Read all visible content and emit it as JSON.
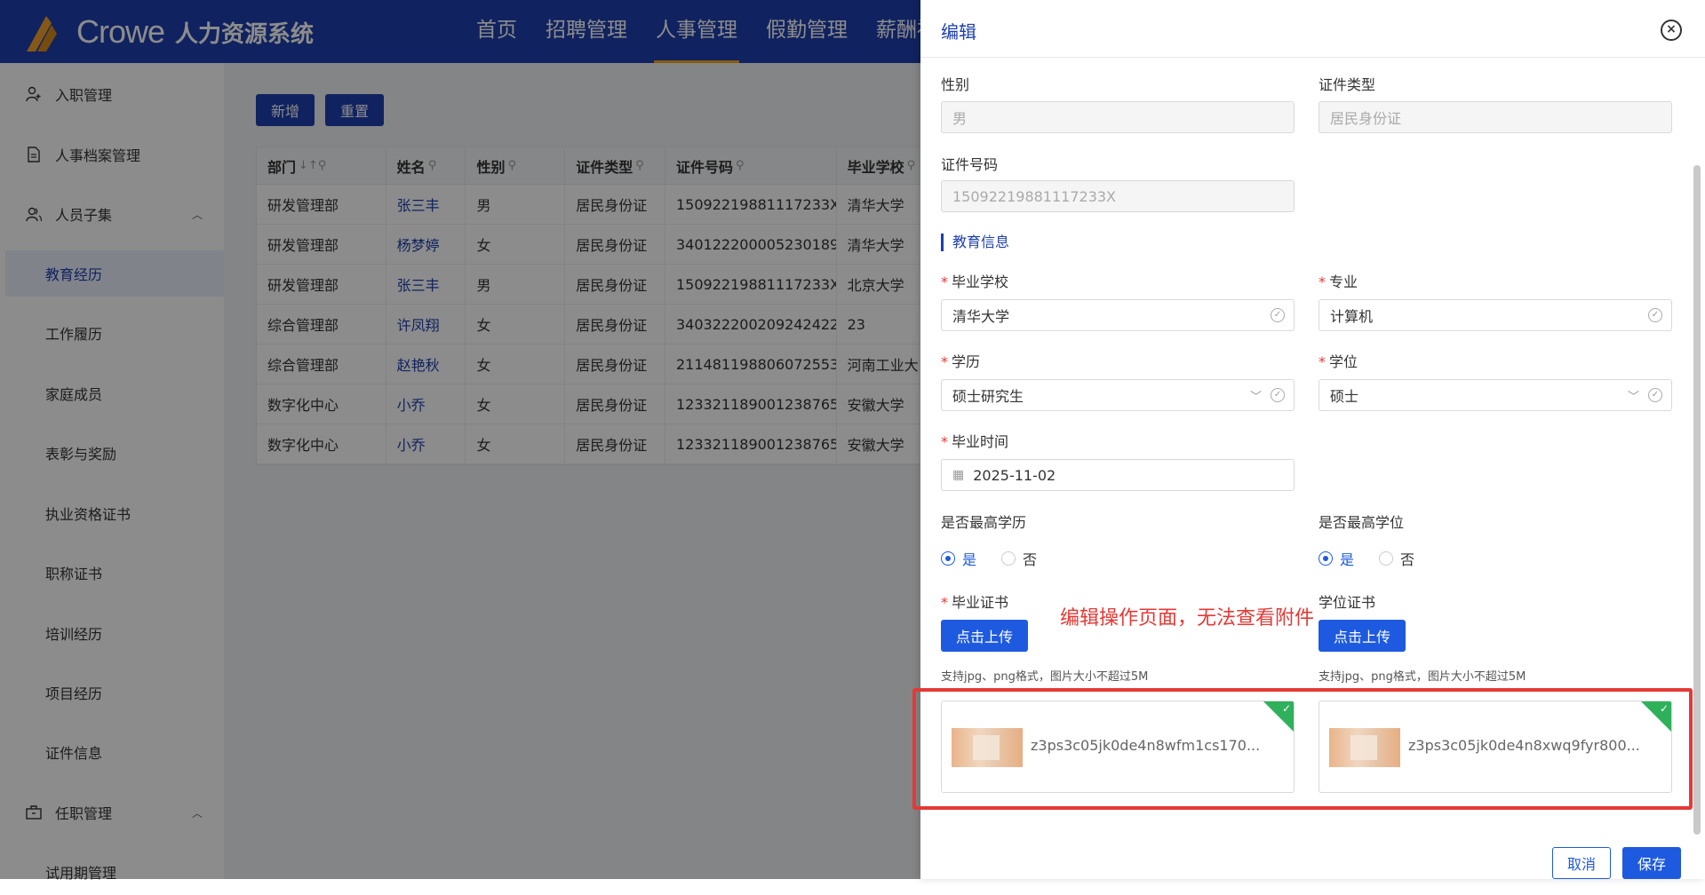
{
  "header": {
    "brand": "Crowe",
    "system_name": "人力资源系统",
    "nav": [
      {
        "label": "首页"
      },
      {
        "label": "招聘管理"
      },
      {
        "label": "人事管理"
      },
      {
        "label": "假勤管理"
      },
      {
        "label": "薪酬福"
      }
    ],
    "active_nav": "人事管理",
    "accent_color": "#1e3fae"
  },
  "sidebar": {
    "items": [
      {
        "label": "入职管理",
        "icon": "user-add-icon"
      },
      {
        "label": "人事档案管理",
        "icon": "document-icon"
      },
      {
        "label": "人员子集",
        "icon": "users-icon"
      },
      {
        "label": "教育经历"
      },
      {
        "label": "工作履历"
      },
      {
        "label": "家庭成员"
      },
      {
        "label": "表彰与奖励"
      },
      {
        "label": "执业资格证书"
      },
      {
        "label": "职称证书"
      },
      {
        "label": "培训经历"
      },
      {
        "label": "项目经历"
      },
      {
        "label": "证件信息"
      },
      {
        "label": "任职管理",
        "icon": "briefcase-icon"
      },
      {
        "label": "试用期管理"
      }
    ],
    "active": "教育经历"
  },
  "toolbar": {
    "add_label": "新增",
    "reset_label": "重置"
  },
  "table": {
    "columns": [
      "部门",
      "姓名",
      "性别",
      "证件类型",
      "证件号码",
      "毕业学校"
    ],
    "rows": [
      [
        "研发管理部",
        "张三丰",
        "男",
        "居民身份证",
        "15092219881117233X",
        "清华大学"
      ],
      [
        "研发管理部",
        "杨梦婷",
        "女",
        "居民身份证",
        "340122200005230189",
        "清华大学"
      ],
      [
        "研发管理部",
        "张三丰",
        "男",
        "居民身份证",
        "15092219881117233X",
        "北京大学"
      ],
      [
        "综合管理部",
        "许凤翔",
        "女",
        "居民身份证",
        "340322200209242422",
        "23"
      ],
      [
        "综合管理部",
        "赵艳秋",
        "女",
        "居民身份证",
        "211481198806072553",
        "河南工业大"
      ],
      [
        "数字化中心",
        "小乔",
        "女",
        "居民身份证",
        "123321189001238765",
        "安徽大学"
      ],
      [
        "数字化中心",
        "小乔",
        "女",
        "居民身份证",
        "123321189001238765",
        "安徽大学"
      ]
    ]
  },
  "drawer": {
    "title": "编辑",
    "fields": {
      "gender": {
        "label": "性别",
        "value": "男"
      },
      "id_type": {
        "label": "证件类型",
        "value": "居民身份证"
      },
      "id_number": {
        "label": "证件号码",
        "value": "15092219881117233X"
      },
      "school": {
        "label": "毕业学校",
        "value": "清华大学"
      },
      "major": {
        "label": "专业",
        "value": "计算机"
      },
      "education": {
        "label": "学历",
        "value": "硕士研究生"
      },
      "degree": {
        "label": "学位",
        "value": "硕士"
      },
      "grad_date": {
        "label": "毕业时间",
        "value": "2025-11-02"
      },
      "highest_edu": {
        "label": "是否最高学历",
        "yes": "是",
        "no": "否",
        "selected": "是"
      },
      "highest_degree": {
        "label": "是否最高学位",
        "yes": "是",
        "no": "否",
        "selected": "是"
      },
      "diploma": {
        "label": "毕业证书",
        "upload_label": "点击上传",
        "hint": "支持jpg、png格式，图片大小不超过5M",
        "file_name": "z3ps3c05jk0de4n8wfm1cs170..."
      },
      "degree_cert": {
        "label": "学位证书",
        "upload_label": "点击上传",
        "hint": "支持jpg、png格式，图片大小不超过5M",
        "file_name": "z3ps3c05jk0de4n8xwq9fyr800..."
      }
    },
    "section_education": "教育信息",
    "annotation": "编辑操作页面，无法查看附件",
    "cancel_label": "取消",
    "save_label": "保存"
  }
}
